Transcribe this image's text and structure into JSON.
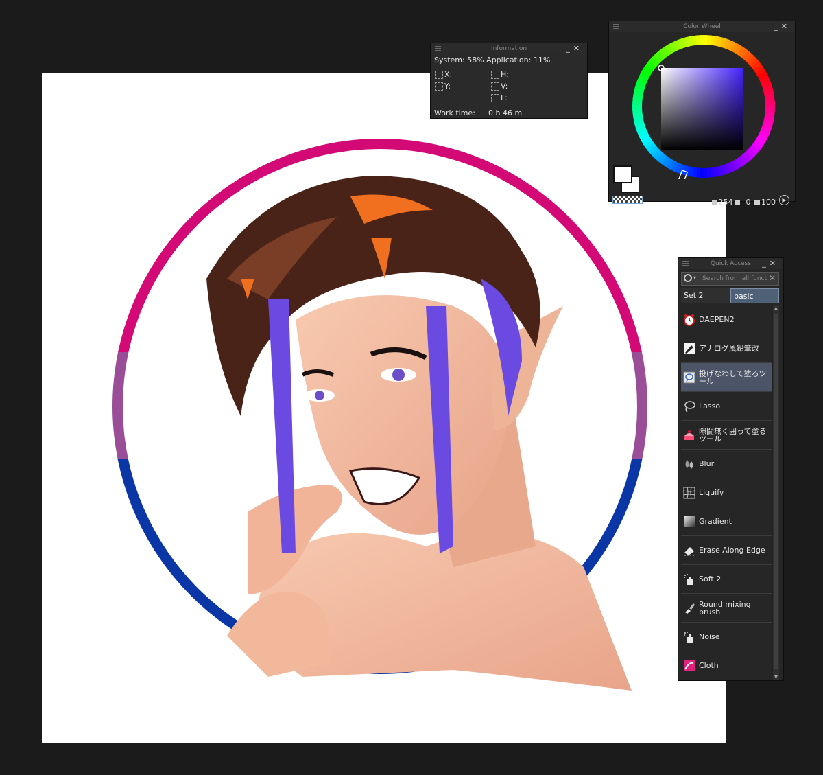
{
  "canvas": {
    "artwork": "artwork"
  },
  "info": {
    "title": "Information",
    "system": "System: 58% Application: 11%",
    "x_label": "X:",
    "y_label": "Y:",
    "h_label": "H:",
    "v_label": "V:",
    "l_label": "L:",
    "worktime_label": "Work time:",
    "worktime_value": "0 h 46 m"
  },
  "colorwheel": {
    "title": "Color Wheel",
    "hue_color": "#4422ff",
    "value_a": "254",
    "value_b": "0",
    "value_c": "100"
  },
  "quickaccess": {
    "title": "Quick Access",
    "search_placeholder": "Search from all functions",
    "set1": "Set 2",
    "set2": "basic",
    "items": [
      {
        "label": "DAEPEN2",
        "icon": "alarm-clock-icon"
      },
      {
        "label": "アナログ風鉛筆改",
        "icon": "pen-nib-icon"
      },
      {
        "label": "投げなわして塗るツール",
        "icon": "lasso-fill-icon"
      },
      {
        "label": "Lasso",
        "icon": "lasso-icon"
      },
      {
        "label": "隙間無く囲って塗るツール",
        "icon": "cake-icon"
      },
      {
        "label": "Blur",
        "icon": "drops-icon"
      },
      {
        "label": "Liquify",
        "icon": "grid-icon"
      },
      {
        "label": "Gradient",
        "icon": "gradient-icon"
      },
      {
        "label": "Erase Along Edge",
        "icon": "eraser-icon"
      },
      {
        "label": "Soft 2",
        "icon": "airbrush-icon"
      },
      {
        "label": "Round mixing brush",
        "icon": "brush-icon"
      },
      {
        "label": "Noise",
        "icon": "airbrush-icon"
      },
      {
        "label": "Cloth",
        "icon": "cloth-icon"
      }
    ]
  }
}
